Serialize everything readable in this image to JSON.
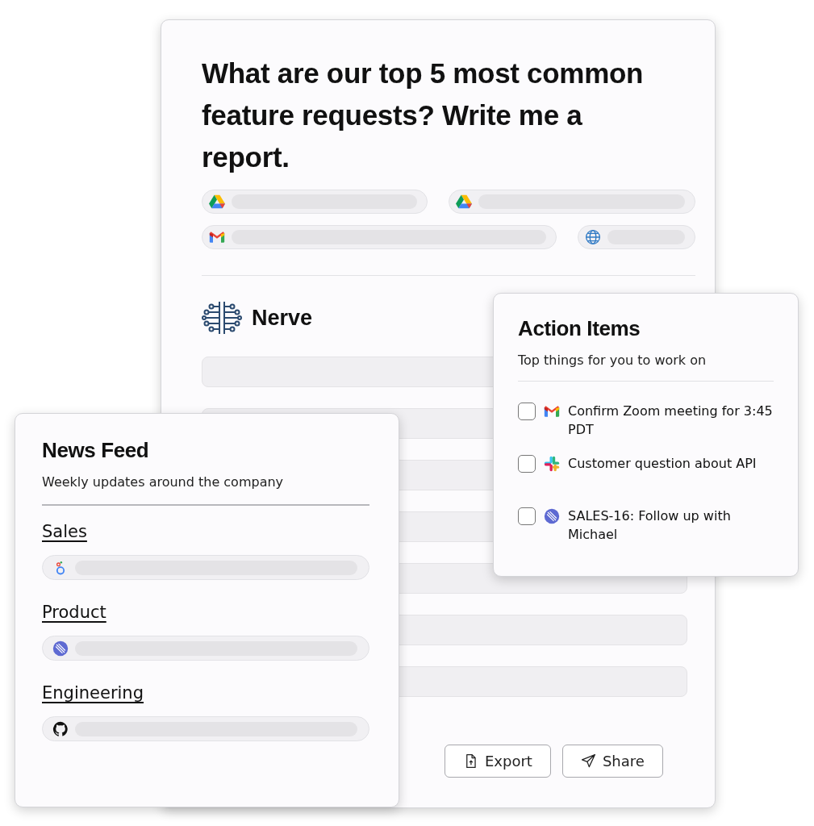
{
  "report": {
    "question": "What are our top 5 most common feature requests? Write me a report.",
    "source_rows": [
      [
        {
          "kind": "drive"
        },
        {
          "kind": "drive"
        }
      ],
      [
        {
          "kind": "gmail"
        },
        {
          "kind": "web"
        }
      ]
    ],
    "assistant": "Nerve",
    "buttons": [
      {
        "kind": "export",
        "label": "Export"
      },
      {
        "kind": "share",
        "label": "Share"
      }
    ]
  },
  "action_items": {
    "title": "Action Items",
    "subtitle": "Top things for you to work on",
    "items": [
      {
        "kind": "gmail",
        "label": "Confirm Zoom meeting for 3:45 PDT",
        "checked": false
      },
      {
        "kind": "slack",
        "label": "Customer question about API",
        "checked": false
      },
      {
        "kind": "linear",
        "label": "SALES-16: Follow up with Michael",
        "checked": false
      }
    ]
  },
  "news_feed": {
    "title": "News Feed",
    "subtitle": "Weekly updates around the company",
    "sections": [
      {
        "heading": "Sales",
        "kind": "looker"
      },
      {
        "heading": "Product",
        "kind": "linear"
      },
      {
        "heading": "Engineering",
        "kind": "github"
      }
    ]
  }
}
